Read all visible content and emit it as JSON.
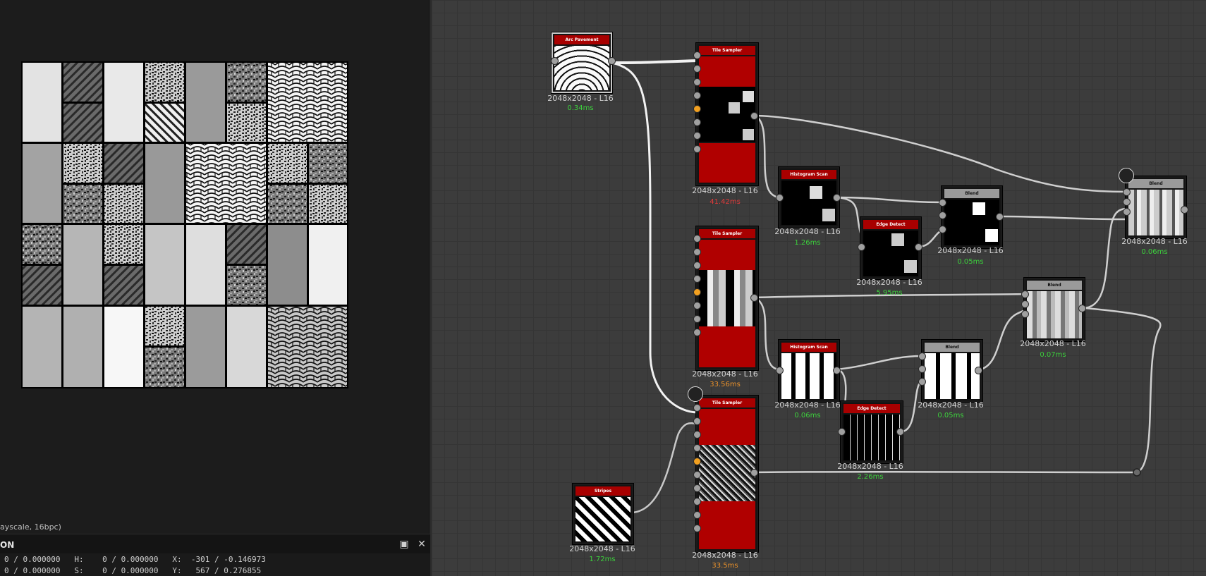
{
  "viewer": {
    "format_text": "ayscale, 16bpc)",
    "info_title": "ON",
    "row1": "0 / 0.000000   H:    0 / 0.000000   X:  -301 / -0.146973",
    "row2": "0 / 0.000000   S:    0 / 0.000000   Y:   567 / 0.276855"
  },
  "icons": {
    "maximize": "maximize-icon",
    "close": "close-icon",
    "comment": "comment-icon",
    "output": "output-icon"
  },
  "nodes": {
    "arc_pavement": {
      "title": "Arc Pavement",
      "res": "2048x2048 - L16",
      "time": "0.34ms",
      "time_color": "#3ccf3c"
    },
    "tile_sampler_1": {
      "title": "Tile Sampler",
      "res": "2048x2048 - L16",
      "time": "41.42ms",
      "time_color": "#e03a3a"
    },
    "tile_sampler_2": {
      "title": "Tile Sampler",
      "res": "2048x2048 - L16",
      "time": "33.56ms",
      "time_color": "#e8902a"
    },
    "tile_sampler_3": {
      "title": "Tile Sampler",
      "res": "2048x2048 - L16",
      "time": "33.5ms",
      "time_color": "#e8902a"
    },
    "stripes": {
      "title": "Stripes",
      "res": "2048x2048 - L16",
      "time": "1.72ms",
      "time_color": "#3ccf3c"
    },
    "histogram_scan_1": {
      "title": "Histogram Scan",
      "res": "2048x2048 - L16",
      "time": "1.26ms",
      "time_color": "#3ccf3c"
    },
    "histogram_scan_2": {
      "title": "Histogram Scan",
      "res": "2048x2048 - L16",
      "time": "0.06ms",
      "time_color": "#3ccf3c"
    },
    "edge_detect_1": {
      "title": "Edge Detect",
      "res": "2048x2048 - L16",
      "time": "5.95ms",
      "time_color": "#3ccf3c"
    },
    "edge_detect_2": {
      "title": "Edge Detect",
      "res": "2048x2048 - L16",
      "time": "2.26ms",
      "time_color": "#3ccf3c"
    },
    "blend_1": {
      "title": "Blend",
      "res": "2048x2048 - L16",
      "time": "0.05ms",
      "time_color": "#3ccf3c"
    },
    "blend_2": {
      "title": "Blend",
      "res": "2048x2048 - L16",
      "time": "0.05ms",
      "time_color": "#3ccf3c"
    },
    "blend_3": {
      "title": "Blend",
      "res": "2048x2048 - L16",
      "time": "0.07ms",
      "time_color": "#3ccf3c"
    },
    "blend_4": {
      "title": "Blend",
      "res": "2048x2048 - L16",
      "time": "0.06ms",
      "time_color": "#3ccf3c"
    }
  }
}
